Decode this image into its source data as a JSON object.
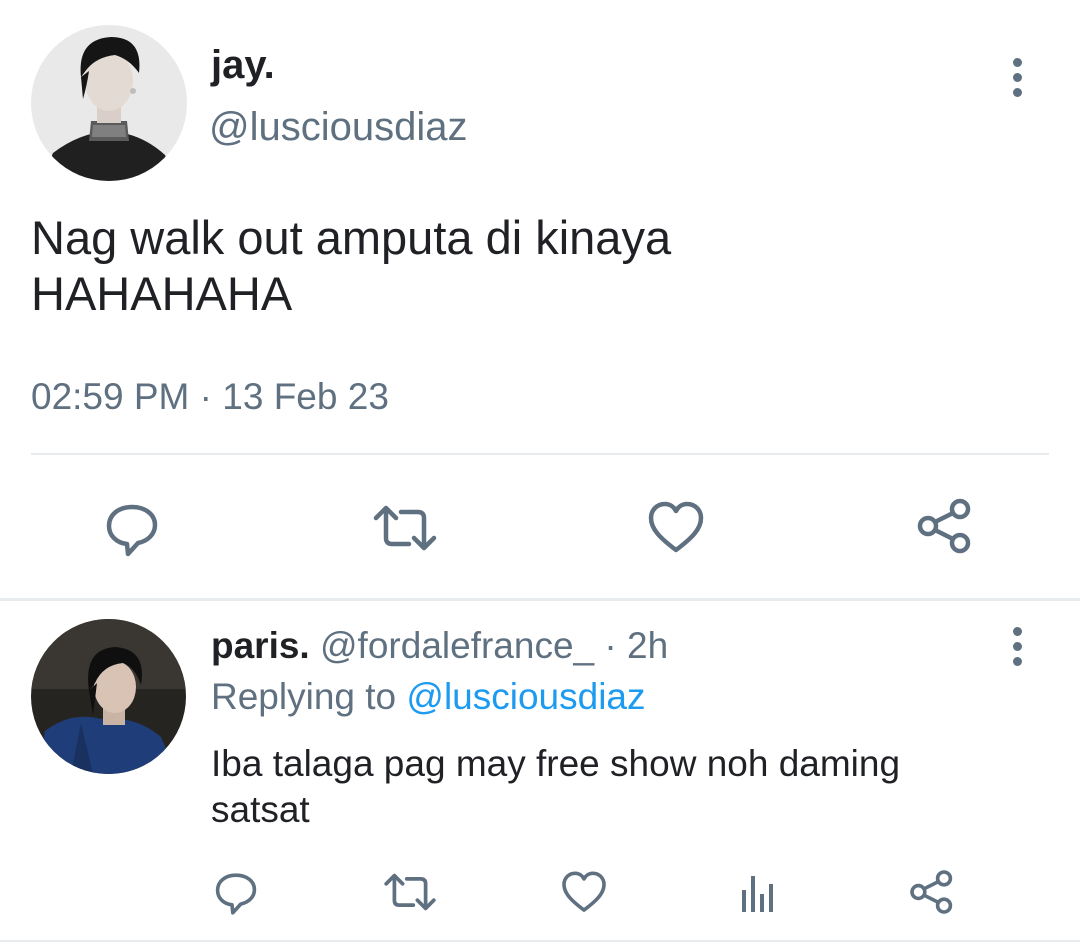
{
  "main_tweet": {
    "display_name": "jay.",
    "handle": "@lusciousdiaz",
    "text_line1": "Nag walk out amputa di kinaya",
    "text_line2": "HAHAHAHA",
    "time": "02:59 PM",
    "separator": "·",
    "date": "13 Feb 23",
    "actions": [
      "reply-icon",
      "retweet-icon",
      "like-icon",
      "share-icon"
    ],
    "menu_icon": "more-vertical-icon"
  },
  "reply": {
    "display_name": "paris.",
    "handle": "@fordalefrance_",
    "separator": "·",
    "age": "2h",
    "replying_prefix": "Replying to",
    "replying_handle": "@lusciousdiaz",
    "text_line1": "Iba talaga pag may free show noh daming",
    "text_line2": "satsat",
    "actions": [
      "reply-icon",
      "retweet-icon",
      "like-icon",
      "analytics-icon",
      "share-icon"
    ],
    "menu_icon": "more-vertical-icon"
  },
  "colors": {
    "text": "#1f2125",
    "secondary": "#5f7080",
    "link": "#1d9bf0",
    "divider": "#e8ecef"
  }
}
